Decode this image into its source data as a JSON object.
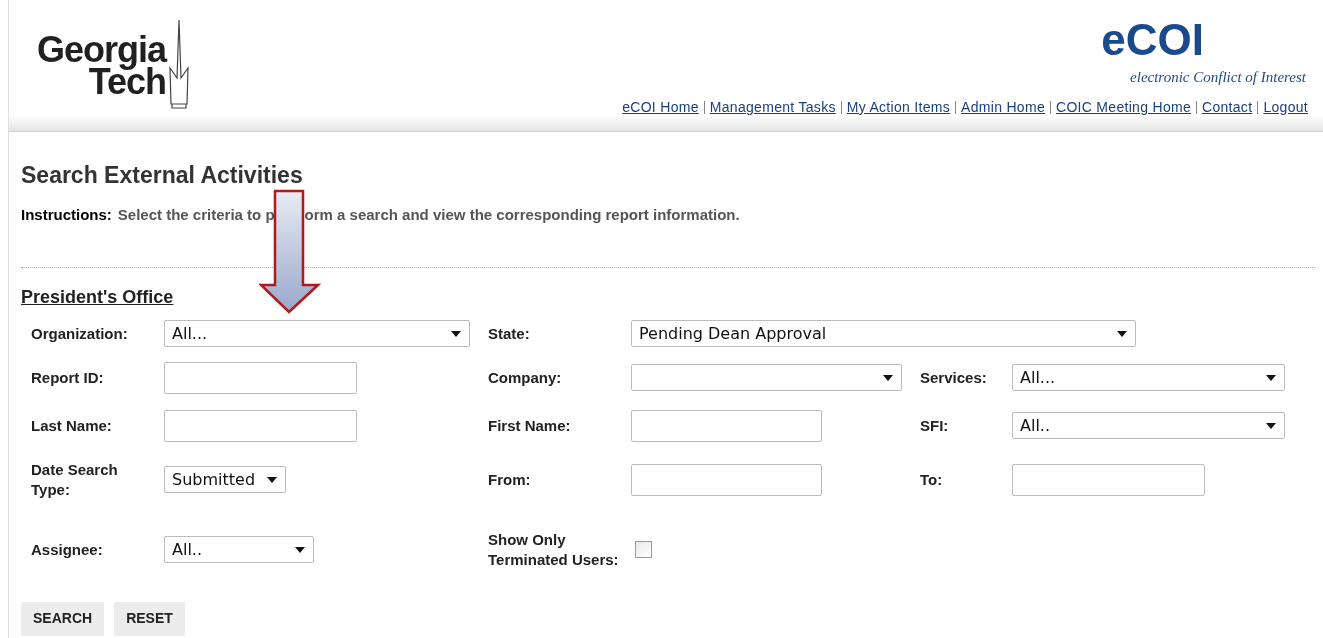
{
  "header": {
    "logo_lines": [
      "Georgia",
      "Tech"
    ],
    "app_title": "eCOI",
    "app_subtitle": "electronic Conflict of Interest",
    "nav_links": [
      "eCOI Home",
      "Management Tasks",
      "My Action Items",
      "Admin Home",
      "COIC Meeting Home",
      "Contact",
      "Logout"
    ]
  },
  "page_title": "Search External Activities",
  "instructions": {
    "label": "Instructions:",
    "text_parts": [
      "Select the criteria to p",
      "orm a search and view the corresponding report information."
    ]
  },
  "section_title": "President's Office",
  "rows": [
    [
      {
        "label": "Organization:",
        "kind": "select",
        "value": "All..."
      },
      {
        "label": "State:",
        "kind": "select",
        "value": "Pending Dean Approval"
      }
    ],
    [
      {
        "label": "Report ID:",
        "kind": "text"
      },
      {
        "label": "Company:",
        "kind": "select"
      },
      {
        "label": "Services:",
        "kind": "select",
        "value": "All..."
      }
    ],
    [
      {
        "label": "Last Name:",
        "kind": "text"
      },
      {
        "label": "First Name:",
        "kind": "text"
      },
      {
        "label": "SFI:",
        "kind": "select",
        "value": "All.."
      }
    ],
    [
      {
        "label": "Date Search Type:",
        "kind": "select",
        "value": "Submitted"
      },
      {
        "label": "From:",
        "kind": "text"
      },
      {
        "label": "To:",
        "kind": "text"
      }
    ],
    [
      {
        "label": "Assignee:",
        "kind": "select",
        "value": "All.."
      },
      {
        "label": "Show Only Terminated Users:",
        "kind": "checkbox",
        "checked": false
      }
    ]
  ],
  "buttons": [
    "SEARCH",
    "RESET"
  ]
}
